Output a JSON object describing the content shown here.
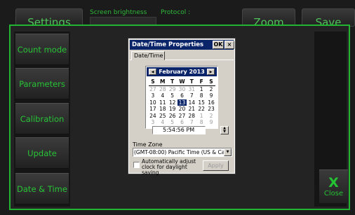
{
  "toolbar": {
    "settings_label": "Settings",
    "screen_brightness_label": "Screen brightness",
    "protocol_label": "Protocol :",
    "zoom_label": "Zoom",
    "save_label": "Save"
  },
  "sidebar": {
    "items": [
      {
        "label": "Count mode"
      },
      {
        "label": "Parameters"
      },
      {
        "label": "Calibration"
      },
      {
        "label": "Update"
      },
      {
        "label": "Date & Time"
      }
    ]
  },
  "close_button": {
    "glyph": "X",
    "label": "Close"
  },
  "dialog": {
    "title": "Date/Time Properties",
    "ok_label": "OK",
    "close_glyph": "×",
    "tab_label": "Date/Time",
    "calendar": {
      "month_year": "February 2013",
      "prev_glyph": "◀",
      "next_glyph": "▶",
      "weekdays": [
        "S",
        "M",
        "T",
        "W",
        "T",
        "F",
        "S"
      ],
      "weeks": [
        [
          "27",
          "28",
          "29",
          "30",
          "31",
          "1",
          "2"
        ],
        [
          "3",
          "4",
          "5",
          "6",
          "7",
          "8",
          "9"
        ],
        [
          "10",
          "11",
          "12",
          "13",
          "14",
          "15",
          "16"
        ],
        [
          "17",
          "18",
          "19",
          "20",
          "21",
          "22",
          "23"
        ],
        [
          "24",
          "25",
          "26",
          "27",
          "28",
          "1",
          "2"
        ],
        [
          "3",
          "4",
          "5",
          "6",
          "7",
          "8",
          "9"
        ]
      ],
      "selected_day": "13"
    },
    "time_value": "5:54:56 PM",
    "timezone_label": "Time Zone",
    "timezone_value": "(GMT-08:00) Pacific Time (US & Ca",
    "dst_label": "Automatically adjust clock for daylight saving",
    "dst_checked": false,
    "apply_label": "Apply"
  },
  "colors": {
    "accent_green": "#23b532",
    "titlebar_blue": "#0a246a",
    "dialog_gray": "#d4d0c8"
  }
}
